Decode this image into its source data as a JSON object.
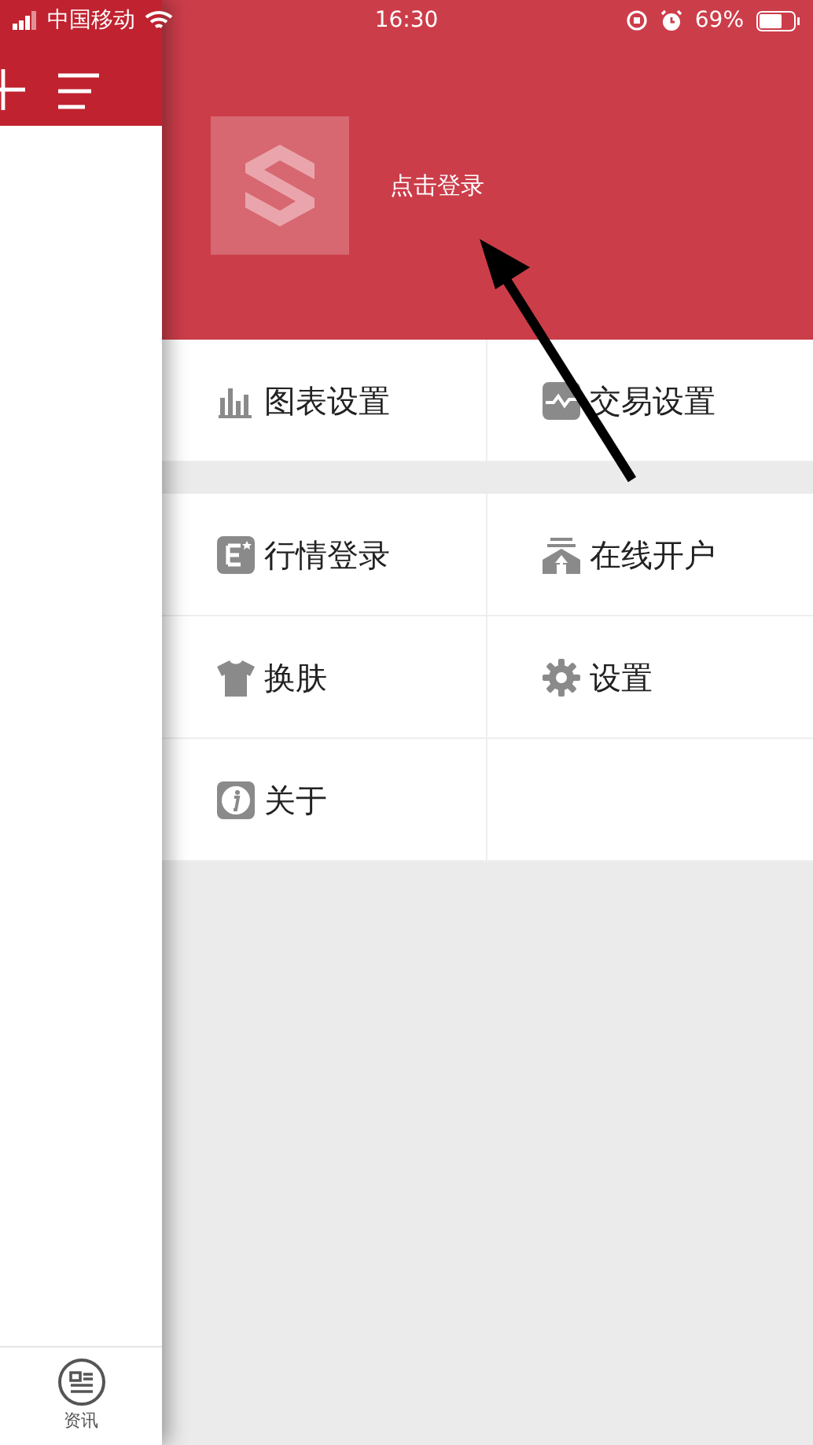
{
  "status_bar": {
    "carrier": "中国移动",
    "time": "16:30",
    "battery": "69%"
  },
  "left_panel": {
    "tab_label": "资讯"
  },
  "drawer": {
    "login_text": "点击登录",
    "sections": [
      {
        "items": [
          {
            "kind": "chart",
            "label": "图表设置"
          },
          {
            "kind": "trade",
            "label": "交易设置"
          }
        ]
      },
      {
        "items": [
          {
            "kind": "market",
            "label": "行情登录"
          },
          {
            "kind": "account",
            "label": "在线开户"
          },
          {
            "kind": "skin",
            "label": "换肤"
          },
          {
            "kind": "gear",
            "label": "设置"
          },
          {
            "kind": "info",
            "label": "关于"
          }
        ]
      }
    ]
  },
  "annotation": {
    "kind": "arrow"
  }
}
